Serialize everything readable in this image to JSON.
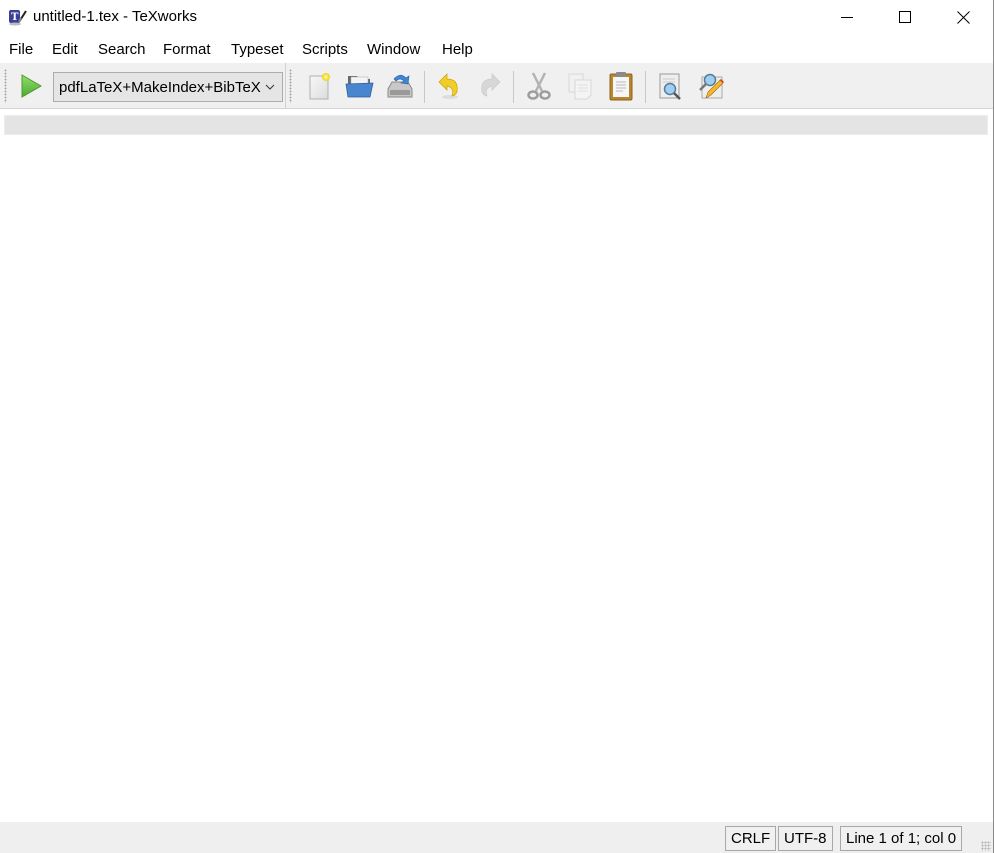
{
  "window": {
    "title": "untitled-1.tex - TeXworks",
    "app_icon": "texworks-logo-icon",
    "controls": {
      "minimize": "minimize-icon",
      "maximize": "maximize-icon",
      "close": "close-icon"
    }
  },
  "menubar": {
    "items": [
      {
        "label": "File"
      },
      {
        "label": "Edit"
      },
      {
        "label": "Search"
      },
      {
        "label": "Format"
      },
      {
        "label": "Typeset"
      },
      {
        "label": "Scripts"
      },
      {
        "label": "Window"
      },
      {
        "label": "Help"
      }
    ]
  },
  "toolbar": {
    "typeset_button": {
      "icon": "play-icon",
      "color": "#6cc04a"
    },
    "engine": {
      "selected": "pdfLaTeX+MakeIndex+BibTeX"
    },
    "buttons": [
      {
        "name": "new",
        "icon": "new-document-icon",
        "enabled": true
      },
      {
        "name": "open",
        "icon": "open-folder-icon",
        "enabled": true
      },
      {
        "name": "save",
        "icon": "save-icon",
        "enabled": true
      },
      {
        "name": "undo",
        "icon": "undo-icon",
        "enabled": true
      },
      {
        "name": "redo",
        "icon": "redo-icon",
        "enabled": false
      },
      {
        "name": "cut",
        "icon": "scissors-icon",
        "enabled": false
      },
      {
        "name": "copy",
        "icon": "copy-icon",
        "enabled": false
      },
      {
        "name": "paste",
        "icon": "clipboard-icon",
        "enabled": true
      },
      {
        "name": "find",
        "icon": "find-icon",
        "enabled": true
      },
      {
        "name": "replace",
        "icon": "find-replace-icon",
        "enabled": true
      }
    ]
  },
  "editor": {
    "content": ""
  },
  "statusbar": {
    "line_ending": "CRLF",
    "encoding": "UTF-8",
    "position": "Line 1 of 1; col 0"
  }
}
